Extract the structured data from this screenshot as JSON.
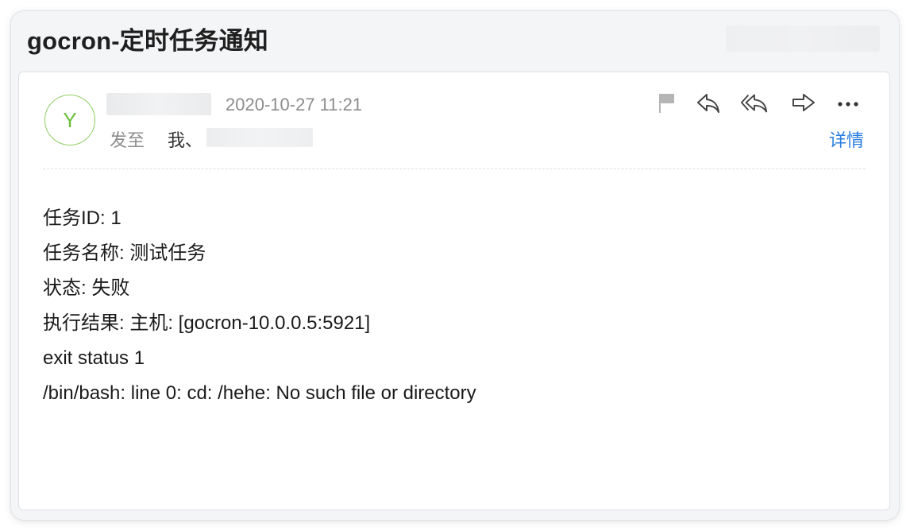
{
  "email": {
    "subject": "gocron-定时任务通知",
    "sender_initial": "Y",
    "date": "2020-10-27 11:21",
    "to_label": "发至",
    "to_me": "我、",
    "details_label": "详情",
    "toolbar_icons": [
      "flag-icon",
      "reply-icon",
      "reply-all-icon",
      "forward-icon",
      "more-icon"
    ],
    "body_lines": [
      "任务ID: 1",
      "任务名称: 测试任务",
      "状态: 失败",
      "执行结果: 主机: [gocron-10.0.0.5:5921]",
      "exit status 1",
      "/bin/bash: line 0: cd: /hehe: No such file or directory"
    ]
  },
  "colors": {
    "accent": "#2a7de1",
    "avatar": "#6cbf3c",
    "muted_text": "#8c8c8c"
  }
}
